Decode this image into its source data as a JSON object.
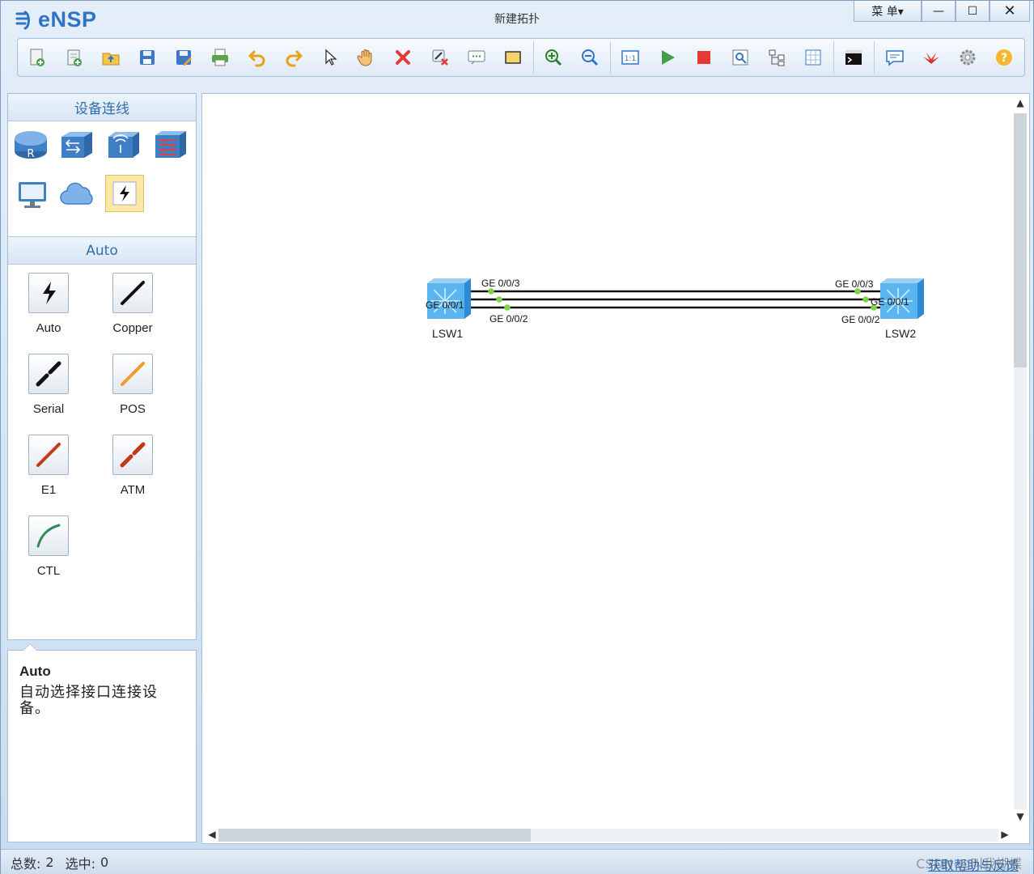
{
  "app": {
    "logo_text": "eNSP",
    "window_title": "新建拓扑",
    "menu_label": "菜 单▾",
    "min_glyph": "—",
    "max_glyph": "☐",
    "close_glyph": "✕"
  },
  "toolbar": {
    "buttons": [
      "new-topology-icon",
      "new-lab-icon",
      "open-icon",
      "save-icon",
      "save-as-icon",
      "print-icon",
      "undo-icon",
      "redo-icon",
      "select-pointer-icon",
      "pan-hand-icon",
      "delete-icon",
      "delete-link-icon",
      "text-note-icon",
      "rectangle-icon",
      "zoom-in-icon",
      "zoom-out-icon",
      "fit-view-icon",
      "start-device-icon",
      "stop-device-icon",
      "capture-icon",
      "topology-tree-icon",
      "grid-icon",
      "console-icon",
      "forum-icon",
      "huawei-icon",
      "settings-icon",
      "help-icon"
    ]
  },
  "left_panel": {
    "device_header": "设备连线",
    "devices": [
      "router-icon",
      "switch-icon",
      "wlan-icon",
      "firewall-icon",
      "pc-icon",
      "cloud-icon",
      "connection-icon"
    ],
    "cable_header": "Auto",
    "cables": [
      {
        "label": "Auto",
        "icon": "auto-cable-icon"
      },
      {
        "label": "Copper",
        "icon": "copper-cable-icon"
      },
      {
        "label": "Serial",
        "icon": "serial-cable-icon"
      },
      {
        "label": "POS",
        "icon": "pos-cable-icon"
      },
      {
        "label": "E1",
        "icon": "e1-cable-icon"
      },
      {
        "label": "ATM",
        "icon": "atm-cable-icon"
      },
      {
        "label": "CTL",
        "icon": "ctl-cable-icon"
      }
    ]
  },
  "description": {
    "title": "Auto",
    "text": "自动选择接口连接设备。"
  },
  "topology": {
    "devices": [
      {
        "name": "LSW1"
      },
      {
        "name": "LSW2"
      }
    ],
    "links": [
      {
        "a_port": "GE 0/0/3",
        "b_port": "GE 0/0/3"
      },
      {
        "a_port": "GE 0/0/1",
        "b_port": "GE 0/0/1"
      },
      {
        "a_port": "GE 0/0/2",
        "b_port": "GE 0/0/2"
      }
    ],
    "link_status_color": "#7ed34a"
  },
  "status": {
    "total_label": "总数:",
    "total_value": "2",
    "selected_label": "选中:",
    "selected_value": "0",
    "feedback": "获取帮助与反馈",
    "watermark": "CSDN @叫我蝴蝶"
  }
}
